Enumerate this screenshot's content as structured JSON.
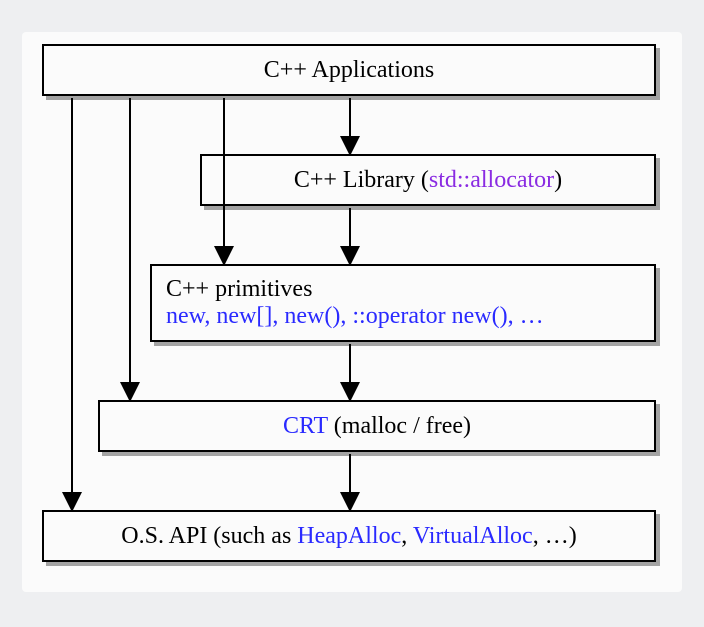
{
  "boxes": {
    "applications": "C++ Applications",
    "library_plain": "C++ Library (",
    "library_alloc": "std::allocator",
    "library_close": ")",
    "primitives_title": "C++ primitives",
    "primitives_list": "new, new[], new(), ::operator new(), …",
    "crt_label": "CRT",
    "crt_paren": " (malloc / free)",
    "osapi_prefix": "O.S. API (such as ",
    "osapi_heap": "HeapAlloc",
    "osapi_sep1": ", ",
    "osapi_virtual": "VirtualAlloc",
    "osapi_suffix": ", …)"
  }
}
